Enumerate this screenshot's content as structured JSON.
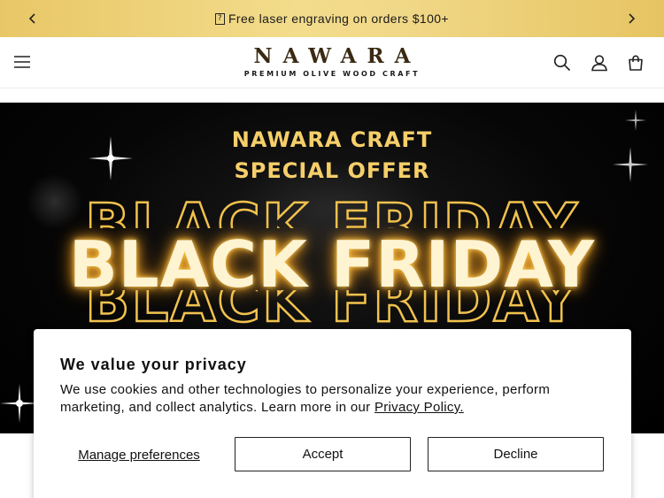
{
  "announcement": {
    "gift_glyph": "🎁",
    "text": "Free laser engraving on orders $100+"
  },
  "header": {
    "brand": "NAWARA",
    "tagline": "PREMIUM OLIVE WOOD CRAFT"
  },
  "hero": {
    "line1": "NAWARA CRAFT",
    "line2": "SPECIAL OFFER",
    "headline": "BLACK FRIDAY"
  },
  "privacy": {
    "title": "We value your privacy",
    "body": "We use cookies and other technologies to personalize your experience, perform marketing, and collect analytics. Learn more in our",
    "link": "Privacy Policy.",
    "manage_label": "Manage preferences",
    "accept_label": "Accept",
    "decline_label": "Decline"
  },
  "colors": {
    "announcement_bg": "#f0d585",
    "hero_text_gold": "#f6cf6a",
    "brand_brown": "#3a2a12"
  }
}
